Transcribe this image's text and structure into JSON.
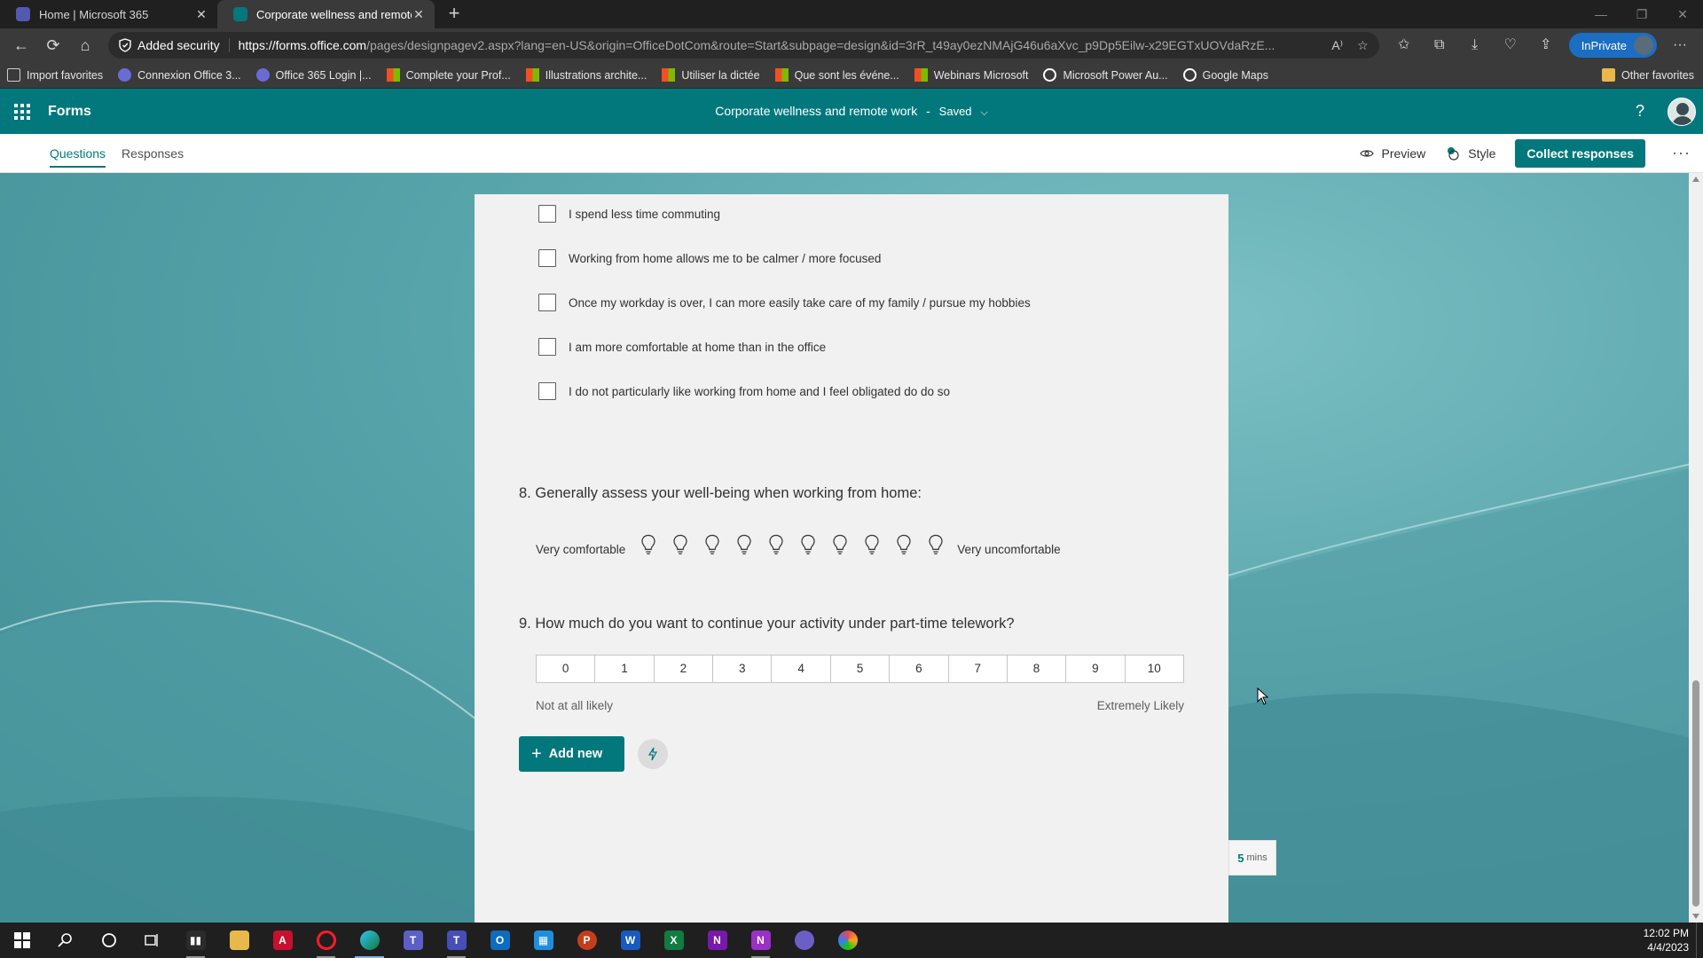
{
  "browser": {
    "tabs": [
      {
        "title": "Home | Microsoft 365",
        "active": false,
        "color": "#6b6bd6"
      },
      {
        "title": "Corporate wellness and remote work",
        "active": true,
        "color": "#03787c"
      }
    ],
    "security_label": "Added security",
    "url_host": "https://forms.office.com",
    "url_path": "/pages/designpagev2.aspx?lang=en-US&origin=OfficeDotCom&route=Start&subpage=design&id=3rR_t49ay0ezNMAjG46u6aXvc_p9Dp5Eilw-x29EGTxUOVdaRzE...",
    "inprivate_label": "InPrivate",
    "favorites": [
      {
        "label": "Import favorites",
        "icon": "import-icon",
        "color": "#cfcfcf"
      },
      {
        "label": "Connexion Office 3...",
        "icon": "office-icon",
        "color": "#6b6bd6"
      },
      {
        "label": "Office 365 Login |...",
        "icon": "office-icon",
        "color": "#6b6bd6"
      },
      {
        "label": "Complete your Prof...",
        "icon": "microsoft-icon",
        "color": "#f3b500"
      },
      {
        "label": "Illustrations archite...",
        "icon": "microsoft-icon",
        "color": "#f3b500"
      },
      {
        "label": "Utiliser la dictée",
        "icon": "microsoft-icon",
        "color": "#f3b500"
      },
      {
        "label": "Que sont les événe...",
        "icon": "microsoft-icon",
        "color": "#f3b500"
      },
      {
        "label": "Webinars Microsoft",
        "icon": "microsoft-icon",
        "color": "#f3b500"
      },
      {
        "label": "Microsoft Power Au...",
        "icon": "google-icon",
        "color": "#ffffff"
      },
      {
        "label": "Google Maps",
        "icon": "google-icon",
        "color": "#ffffff"
      }
    ],
    "other_favorites": "Other favorites"
  },
  "forms": {
    "app_name": "Forms",
    "doc_title": "Corporate wellness and remote work",
    "separator": "-",
    "save_state": "Saved",
    "tabs": [
      "Questions",
      "Responses"
    ],
    "preview_label": "Preview",
    "style_label": "Style",
    "collect_label": "Collect responses",
    "accent": "#03787c"
  },
  "question7": {
    "options": [
      "I spend less time commuting",
      "Working from home allows me to be calmer / more focused",
      "Once my workday is over, I can more easily take care of my family / pursue my hobbies",
      "I am more comfortable at home than in the office",
      "I do not particularly like working from home and I feel obligated do do so"
    ]
  },
  "question8": {
    "number": "8.",
    "title": "Generally assess your well-being when working from home:",
    "left_label": "Very comfortable",
    "right_label": "Very uncomfortable",
    "levels": 10,
    "icon": "lightbulb-icon"
  },
  "question9": {
    "number": "9.",
    "title": "How much do you want to continue your activity under part-time telework?",
    "scale": [
      "0",
      "1",
      "2",
      "3",
      "4",
      "5",
      "6",
      "7",
      "8",
      "9",
      "10"
    ],
    "low_label": "Not at all likely",
    "high_label": "Extremely Likely"
  },
  "actions": {
    "add_new_label": "Add new"
  },
  "timer": {
    "value": "5",
    "unit": "mins"
  },
  "taskbar": {
    "time": "12:02 PM",
    "date": "4/4/2023"
  }
}
